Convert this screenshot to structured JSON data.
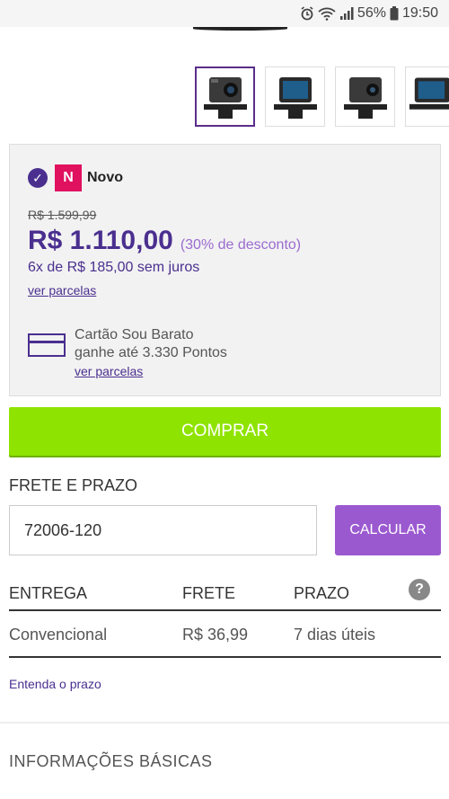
{
  "status_bar": {
    "battery": "56%",
    "time": "19:50",
    "icons": [
      "alarm-icon",
      "wifi-icon",
      "signal-icon",
      "battery-icon"
    ]
  },
  "gallery": {
    "thumbnails": [
      "camera-front",
      "camera-screen",
      "camera-side",
      "camera-back"
    ]
  },
  "product": {
    "condition_badge": "N",
    "condition_label": "Novo",
    "old_price": "R$ 1.599,99",
    "price": "R$ 1.110,00",
    "discount": "(30% de desconto)",
    "installments": "6x de R$ 185,00 sem juros",
    "ver_parcelas": "ver parcelas",
    "card_name": "Cartão Sou Barato",
    "card_points": "ganhe até 3.330 Pontos",
    "card_ver_parcelas": "ver parcelas"
  },
  "actions": {
    "buy_label": "COMPRAR"
  },
  "shipping": {
    "title": "FRETE E PRAZO",
    "cep_value": "72006-120",
    "calc_label": "CALCULAR",
    "headers": [
      "ENTREGA",
      "FRETE",
      "PRAZO"
    ],
    "help": "?",
    "rows": [
      {
        "entrega": "Convencional",
        "frete": "R$ 36,99",
        "prazo": "7 dias úteis"
      }
    ],
    "entenda_link": "Entenda o prazo"
  },
  "info": {
    "title": "INFORMAÇÕES BÁSICAS"
  },
  "colors": {
    "brand_purple": "#4a2f8f",
    "buy_green": "#8fe300",
    "calc_purple": "#9b59d0",
    "badge_pink": "#e0115f"
  }
}
